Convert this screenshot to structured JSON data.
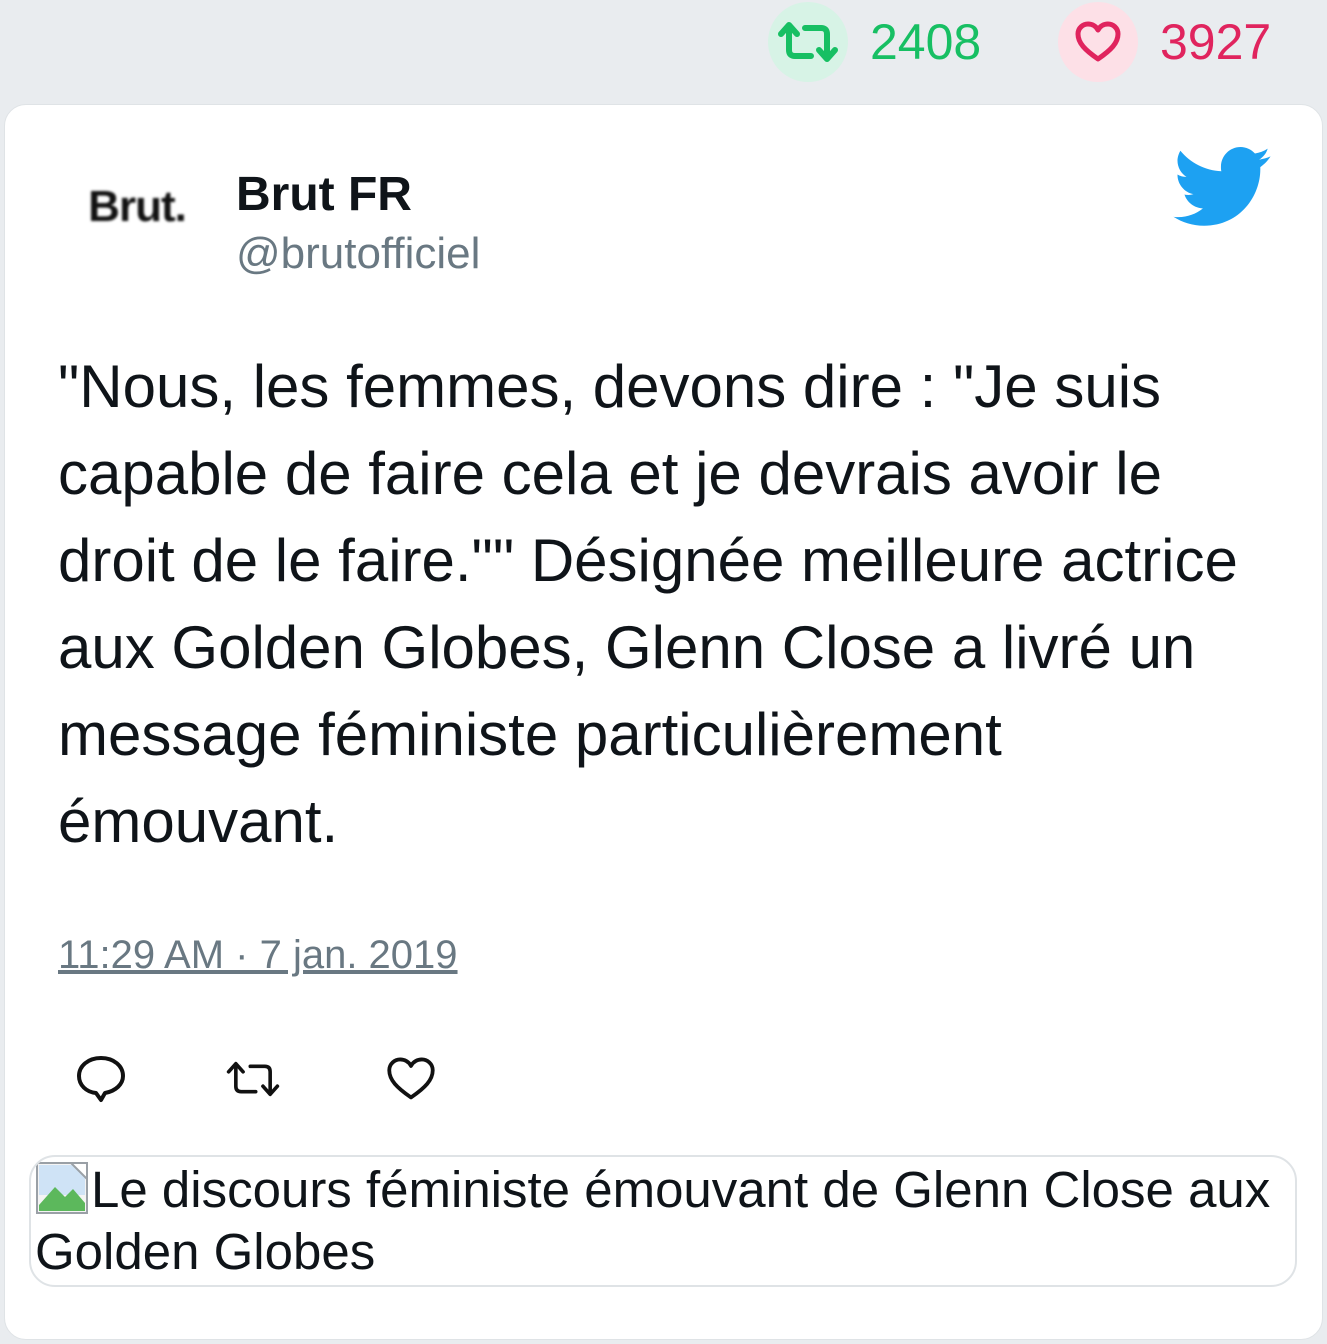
{
  "stats": {
    "retweet_count": "2408",
    "like_count": "3927",
    "retweet_icon": "retweet-icon",
    "like_icon": "heart-icon",
    "retweet_color": "#17bf63",
    "like_color": "#e0245e"
  },
  "tweet": {
    "avatar_text": "Brut.",
    "display_name": "Brut FR",
    "handle": "@brutofficiel",
    "brand_icon": "twitter-bird-icon",
    "brand_color": "#1da1f2",
    "text": "\"Nous, les femmes, devons dire : \"Je suis capable de faire cela et je devrais avoir le droit de le faire.\"\" Désignée meilleure actrice aux Golden Globes, Glenn Close a livré un message féministe particulièrement émouvant.",
    "timestamp": "11:29 AM · 7 jan. 2019",
    "actions": [
      "reply-icon",
      "retweet-icon",
      "heart-icon"
    ],
    "media_alt": "Le discours féministe émouvant de Glenn Close aux Golden Globes"
  }
}
